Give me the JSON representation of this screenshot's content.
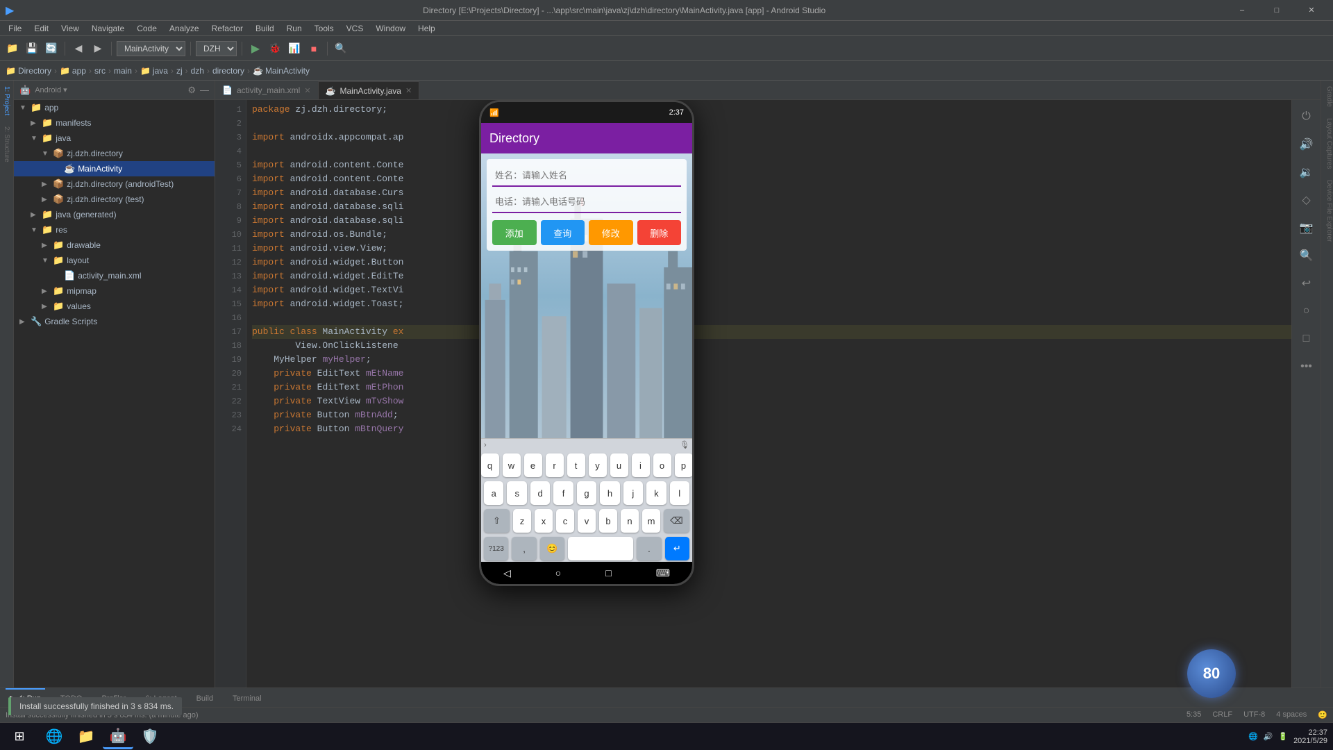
{
  "titlebar": {
    "title": "Directory [E:\\Projects\\Directory] - ...\\app\\src\\main\\java\\zj\\dzh\\directory\\MainActivity.java [app] - Android Studio",
    "minimize": "–",
    "maximize": "□",
    "close": "✕"
  },
  "menubar": {
    "items": [
      "File",
      "Edit",
      "View",
      "Navigate",
      "Code",
      "Analyze",
      "Refactor",
      "Build",
      "Run",
      "Tools",
      "VCS",
      "Window",
      "Help"
    ]
  },
  "toolbar": {
    "project_dropdown": "MainActivityä",
    "run_config": "DZH",
    "search_label": "🔍"
  },
  "breadcrumb": {
    "items": [
      "Directory",
      "app",
      "src",
      "main",
      "java",
      "zj",
      "dzh",
      "directory",
      "MainActivity"
    ]
  },
  "sidebar": {
    "header": "Android",
    "tree": [
      {
        "label": "app",
        "type": "folder",
        "level": 0,
        "expanded": true
      },
      {
        "label": "manifests",
        "type": "folder",
        "level": 1,
        "expanded": false
      },
      {
        "label": "java",
        "type": "folder",
        "level": 1,
        "expanded": true
      },
      {
        "label": "zj.dzh.directory",
        "type": "package",
        "level": 2,
        "expanded": true
      },
      {
        "label": "MainActivity",
        "type": "java",
        "level": 3,
        "selected": true
      },
      {
        "label": "zj.dzh.directory (androidTest)",
        "type": "package",
        "level": 2,
        "expanded": false
      },
      {
        "label": "zj.dzh.directory (test)",
        "type": "package",
        "level": 2,
        "expanded": false
      },
      {
        "label": "java (generated)",
        "type": "folder",
        "level": 1,
        "expanded": false
      },
      {
        "label": "res",
        "type": "folder",
        "level": 1,
        "expanded": true
      },
      {
        "label": "drawable",
        "type": "folder",
        "level": 2,
        "expanded": false
      },
      {
        "label": "layout",
        "type": "folder",
        "level": 2,
        "expanded": true
      },
      {
        "label": "activity_main.xml",
        "type": "xml",
        "level": 3,
        "expanded": false
      },
      {
        "label": "mipmap",
        "type": "folder",
        "level": 2,
        "expanded": false
      },
      {
        "label": "values",
        "type": "folder",
        "level": 2,
        "expanded": false
      },
      {
        "label": "Gradle Scripts",
        "type": "folder",
        "level": 0,
        "expanded": false
      }
    ]
  },
  "editor": {
    "tabs": [
      {
        "label": "activity_main.xml",
        "active": false,
        "icon": "xml"
      },
      {
        "label": "MainActivity.java",
        "active": true,
        "icon": "java"
      }
    ],
    "lines": [
      {
        "num": 1,
        "code": "package zj.dzh.directory;",
        "tokens": [
          {
            "text": "package ",
            "cls": "kw"
          },
          {
            "text": "zj.dzh.directory",
            "cls": "pkg"
          },
          {
            "text": ";",
            "cls": ""
          }
        ]
      },
      {
        "num": 2,
        "code": "",
        "tokens": []
      },
      {
        "num": 3,
        "code": "import androidx.appcompat.ap",
        "tokens": [
          {
            "text": "import ",
            "cls": "import-kw"
          },
          {
            "text": "androidx.appcompat.ap",
            "cls": "import-path"
          }
        ]
      },
      {
        "num": 4,
        "code": "",
        "tokens": []
      },
      {
        "num": 5,
        "code": "import android.content.Conte",
        "tokens": [
          {
            "text": "import ",
            "cls": "import-kw"
          },
          {
            "text": "android.content.Conte",
            "cls": "import-path"
          }
        ]
      },
      {
        "num": 6,
        "code": "import android.content.Conte",
        "tokens": [
          {
            "text": "import ",
            "cls": "import-kw"
          },
          {
            "text": "android.content.Conte",
            "cls": "import-path"
          }
        ]
      },
      {
        "num": 7,
        "code": "import android.database.Curs",
        "tokens": [
          {
            "text": "import ",
            "cls": "import-kw"
          },
          {
            "text": "android.database.Curs",
            "cls": "import-path"
          }
        ]
      },
      {
        "num": 8,
        "code": "import android.database.sqli",
        "tokens": [
          {
            "text": "import ",
            "cls": "import-kw"
          },
          {
            "text": "android.database.sqli",
            "cls": "import-path"
          }
        ]
      },
      {
        "num": 9,
        "code": "import android.database.sqli",
        "tokens": [
          {
            "text": "import ",
            "cls": "import-kw"
          },
          {
            "text": "android.database.sqli",
            "cls": "import-path"
          }
        ]
      },
      {
        "num": 10,
        "code": "import android.os.Bundle;",
        "tokens": [
          {
            "text": "import ",
            "cls": "import-kw"
          },
          {
            "text": "android.os.Bundle",
            "cls": "import-path"
          },
          {
            "text": ";",
            "cls": ""
          }
        ]
      },
      {
        "num": 11,
        "code": "import android.view.View;",
        "tokens": [
          {
            "text": "import ",
            "cls": "import-kw"
          },
          {
            "text": "android.view.View",
            "cls": "import-path"
          },
          {
            "text": ";",
            "cls": ""
          }
        ]
      },
      {
        "num": 12,
        "code": "import android.widget.Button",
        "tokens": [
          {
            "text": "import ",
            "cls": "import-kw"
          },
          {
            "text": "android.widget.Button",
            "cls": "import-path"
          }
        ]
      },
      {
        "num": 13,
        "code": "import android.widget.EditTe",
        "tokens": [
          {
            "text": "import ",
            "cls": "import-kw"
          },
          {
            "text": "android.widget.EditTe",
            "cls": "import-path"
          }
        ]
      },
      {
        "num": 14,
        "code": "import android.widget.TextVi",
        "tokens": [
          {
            "text": "import ",
            "cls": "import-kw"
          },
          {
            "text": "android.widget.TextVi",
            "cls": "import-path"
          }
        ]
      },
      {
        "num": 15,
        "code": "import android.widget.Toast;",
        "tokens": [
          {
            "text": "import ",
            "cls": "import-kw"
          },
          {
            "text": "android.widget.Toast",
            "cls": "import-path"
          },
          {
            "text": ";",
            "cls": ""
          }
        ]
      },
      {
        "num": 16,
        "code": "",
        "tokens": []
      },
      {
        "num": 17,
        "code": "public class MainActivity ex",
        "tokens": [
          {
            "text": "public ",
            "cls": "kw"
          },
          {
            "text": "class ",
            "cls": "kw"
          },
          {
            "text": "MainActivity ",
            "cls": "cls"
          },
          {
            "text": "ex",
            "cls": ""
          }
        ]
      },
      {
        "num": 18,
        "code": "        View.OnClickListene",
        "tokens": [
          {
            "text": "        View.OnClickListene",
            "cls": "import-path"
          }
        ]
      },
      {
        "num": 19,
        "code": "    MyHelper myHelper;",
        "tokens": [
          {
            "text": "    ",
            "cls": ""
          },
          {
            "text": "MyHelper ",
            "cls": "cls"
          },
          {
            "text": "myHelper",
            "cls": "kw2"
          },
          {
            "text": ";",
            "cls": ""
          }
        ]
      },
      {
        "num": 20,
        "code": "    private EditText mEtName",
        "tokens": [
          {
            "text": "    ",
            "cls": ""
          },
          {
            "text": "private ",
            "cls": "kw"
          },
          {
            "text": "EditText ",
            "cls": "cls"
          },
          {
            "text": "mEtName",
            "cls": "kw2"
          }
        ]
      },
      {
        "num": 21,
        "code": "    private EditText mEtPhon",
        "tokens": [
          {
            "text": "    ",
            "cls": ""
          },
          {
            "text": "private ",
            "cls": "kw"
          },
          {
            "text": "EditText ",
            "cls": "cls"
          },
          {
            "text": "mEtPhon",
            "cls": "kw2"
          }
        ]
      },
      {
        "num": 22,
        "code": "    private TextView mTvShow",
        "tokens": [
          {
            "text": "    ",
            "cls": ""
          },
          {
            "text": "private ",
            "cls": "kw"
          },
          {
            "text": "TextView ",
            "cls": "cls"
          },
          {
            "text": "mTvShow",
            "cls": "kw2"
          }
        ]
      },
      {
        "num": 23,
        "code": "    private Button mBtnAdd;",
        "tokens": [
          {
            "text": "    ",
            "cls": ""
          },
          {
            "text": "private ",
            "cls": "kw"
          },
          {
            "text": "Button ",
            "cls": "cls"
          },
          {
            "text": "mBtnAdd",
            "cls": "kw2"
          },
          {
            "text": ";",
            "cls": ""
          }
        ]
      },
      {
        "num": 24,
        "code": "    private Button mBtnQuery",
        "tokens": [
          {
            "text": "    ",
            "cls": ""
          },
          {
            "text": "private ",
            "cls": "kw"
          },
          {
            "text": "Button ",
            "cls": "cls"
          },
          {
            "text": "mBtnQuery",
            "cls": "kw2"
          }
        ]
      }
    ]
  },
  "phone": {
    "status_time": "2:37",
    "app_title": "Directory",
    "name_placeholder": "姓名：请输入姓名",
    "phone_placeholder": "电话：请输入电话号码",
    "btn_add": "添加",
    "btn_query": "查询",
    "btn_edit": "修改",
    "btn_delete": "删除",
    "keyboard": {
      "row1": [
        "q",
        "w",
        "e",
        "r",
        "t",
        "y",
        "u",
        "i",
        "o",
        "p"
      ],
      "row2": [
        "a",
        "s",
        "d",
        "f",
        "g",
        "h",
        "j",
        "k",
        "l"
      ],
      "row3": [
        "⇧",
        "z",
        "x",
        "c",
        "v",
        "b",
        "n",
        "m",
        "⌫"
      ],
      "row4": [
        "?123",
        ",",
        "😊",
        " ",
        ".",
        "↵"
      ]
    }
  },
  "bottom_tabs": [
    {
      "label": "4: Run",
      "icon": "▶",
      "active": false
    },
    {
      "label": "TODO",
      "icon": "≡",
      "active": false
    },
    {
      "label": "Profiler",
      "icon": "📊",
      "active": false
    },
    {
      "label": "6: Logcat",
      "icon": "📋",
      "active": false
    },
    {
      "label": "Build",
      "icon": "🔨",
      "active": false
    },
    {
      "label": "Terminal",
      "icon": "$",
      "active": false
    }
  ],
  "status_bar": {
    "message": "Install successfully finished in 3 s 834 ms. (a minute ago)",
    "position": "5:35",
    "line_sep": "CRLF",
    "encoding": "UTF-8",
    "indent": "4 spaces"
  },
  "toast": {
    "message": "Install successfully finished in 3 s 834 ms."
  },
  "taskbar": {
    "time": "22:37",
    "date": "2021/5/29",
    "apps": [
      "⊞",
      "🌐",
      "📁",
      "🔵",
      "🛡️"
    ]
  }
}
